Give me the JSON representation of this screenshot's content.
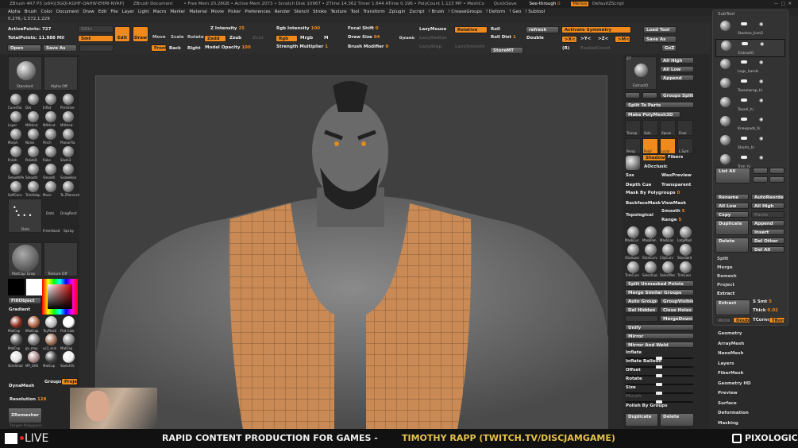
{
  "title": {
    "app": "ZBrush 4R7 P3 (x64)[3GQI-KGHF-QAHW-EHMI-NYAP]",
    "doc": "ZBrush Document",
    "stats": "• Free Mem 20.28GB • Active Mem 2073 • Scratch Disk 10967 • ZTime 14.362 Timer 1.644 ATime 0.196 • PolyCount 1.123 MP • MeshCo",
    "quicksave": "QuickSave",
    "seethrough": "See-through",
    "seethrough_val": "0",
    "menus": "Menus",
    "script": "DefaultZScript"
  },
  "menu": [
    "Alpha",
    "Brush",
    "Color",
    "Document",
    "Draw",
    "Edit",
    "File",
    "Layer",
    "Light",
    "Macro",
    "Marker",
    "Material",
    "Movie",
    "Picker",
    "Preferences",
    "Render",
    "Stencil",
    "Stroke",
    "Texture",
    "Tool",
    "Transform",
    "Zplugin",
    "Zscript",
    "! Brush",
    "! CreaseGroups",
    "! Deform",
    "! Geo",
    "! Subtool"
  ],
  "coords": "0.276,-1.572,1.229",
  "toolbar": {
    "active_points": "ActivePoints: 727",
    "total_points": "TotalPoints: 11.988 Mil",
    "sdiv": "SDiv",
    "smt": "Smt",
    "open": "Open",
    "save_as": "Save As",
    "edit": "Edit",
    "draw": "Draw",
    "move": "Move",
    "scale": "Scale",
    "rotate": "Rotate",
    "front": "Front",
    "back": "Back",
    "right": "Right",
    "z_intensity": "Z Intensity",
    "z_intensity_val": "25",
    "zadd": "Zadd",
    "zsub": "Zsub",
    "zcut": "Zcut",
    "model_opacity": "Model Opacity",
    "model_opacity_val": "100",
    "rgb_intensity": "Rgb Intensity",
    "rgb_intensity_val": "100",
    "rgb": "Rgb",
    "mrgb": "Mrgb",
    "m": "M",
    "strength_mult": "Strength Multiplier",
    "strength_mult_val": "1",
    "focal_shift": "Focal Shift",
    "focal_shift_val": "0",
    "draw_size": "Draw Size",
    "draw_size_val": "94",
    "dynamic": "Dynamic",
    "brush_modifier": "Brush Modifier",
    "brush_modifier_val": "0",
    "lazymouse": "LazyMouse",
    "lazyradius": "LazyRadius",
    "lazystep": "LazyStep",
    "lazysmooth": "LazySmooth",
    "relative": "Relative",
    "roll": "Roll",
    "roll_dist": "Roll Dist",
    "roll_dist_val": "1",
    "storemt": "StoreMT",
    "refresh": "refresh",
    "double": "Double",
    "activate_symmetry": "Activate Symmetry",
    "sym_x": ">X<",
    "sym_y": ">Y<",
    "sym_z": ">Z<",
    "sym_m": ">M<",
    "r": "(R)",
    "radial_count": "RadialCount",
    "load_tool": "Load Tool",
    "save_as2": "Save As",
    "goz": "GoZ"
  },
  "left": {
    "brush": "Standard",
    "alpha": "Alpha Off",
    "brushes": [
      "CurveTul",
      "Dot",
      "Inflat",
      "Primitive",
      "Layer",
      "MAHcut",
      "MAHcut",
      "MAHcut",
      "Morph",
      "Noise",
      "Pinch",
      "PlanarFla",
      "Polish",
      "PolishD",
      "Rake",
      "Slash3",
      "SmoothPe",
      "Smooth",
      "Smooth",
      "SnakeHoo",
      "SoftConc",
      "TrimAdap",
      "Move",
      "To ZRemesh"
    ],
    "stroke": "Dots",
    "stroke2": "Dots",
    "dragrect": "DragRect",
    "freehand": "FreeHand",
    "spray": "Spray",
    "material": "MatCap Gray",
    "texture": "Texture Off",
    "fill_object": "FillObject",
    "gradient": "Gradient",
    "materials": [
      "MatCap",
      "IMatCap",
      "ToyPlasti",
      "Flat Colo",
      "MatCap",
      "gv_may",
      "uc2_skin",
      "MatCap",
      "SkinShad",
      "MP_GRE",
      "MatCap",
      "SketchTo"
    ],
    "dynamesh": "DynaMesh",
    "groups": "Groups",
    "project": "Projec",
    "resolution": "Resolution",
    "resolution_val": "128",
    "zremesher": "ZRemesher",
    "target": "Target Polygons"
  },
  "tool": {
    "count": "27",
    "name": "Extract0",
    "all_high": "All High",
    "all_low": "All Low",
    "append": "Append",
    "groups_split": "Groups Split",
    "split_parts": "Split To Parts",
    "make_polymesh": "Make PolyMesh3D",
    "icons": [
      "Transp",
      "Solo",
      "Xpose",
      "Floor",
      "Persp",
      "PolyF",
      "Local",
      "L.Sym"
    ],
    "shadows": "Shadows",
    "fibers": "Fibers",
    "aocclusion": "AOcclusic",
    "sss": "Sss",
    "waxpreview": "WaxPreview",
    "depth_cue": "Depth Cue",
    "transparent": "Transparent",
    "mask_polygroups": "Mask By Polygroups",
    "mask_polygroups_val": "0",
    "backfacemask": "BackfaceMask",
    "viewmask": "ViewMask",
    "topological": "Topological",
    "smooth": "Smooth",
    "smooth_val": "5",
    "range": "Range",
    "range_val": "5",
    "mask_icons": [
      "MaskCur",
      "MaskPen",
      "MaskLas",
      "LazyMasl",
      "SliceLass",
      "SliceCurv",
      "ClipCurv",
      "Standard",
      "TrimCurv",
      "SelectLas",
      "SelectRec",
      "TrimLass"
    ],
    "split_unmasked": "Split Unmasked Points",
    "merge_similar": "Merge Similar Groups",
    "auto_groups": "Auto Groups",
    "group_visible": "GroupVisible",
    "del_hidden": "Del Hidden",
    "close_holes": "Close Holes",
    "mergedown": "MergeDown",
    "unify": "Unify",
    "mirror": "Mirror",
    "mirror_weld": "Mirror And Weld",
    "inflate": "Inflate",
    "inflate_balloon": "Inflate Balloon",
    "offset": "Offset",
    "rotate": "Rotate",
    "size": "Size",
    "morph": "Morph",
    "polish_groups": "Polish By Groups",
    "duplicate": "Duplicate",
    "delete": "Delete"
  },
  "subtool": {
    "title": "SubTool",
    "items": [
      "Stanton_Icon2",
      "Extract0",
      "Legs_hands",
      "Tasselwrap_hi",
      "Tassel_hi",
      "Kneepads_hi",
      "Shorts_hi",
      "Trim_hi"
    ],
    "list_all": "List All",
    "rename": "Rename",
    "autoreorder": "AutoReorder",
    "all_low": "All Low",
    "all_high": "All High",
    "copy": "Copy",
    "paste": "Paste",
    "duplicate": "Duplicate",
    "append": "Append",
    "insert": "Insert",
    "delete": "Delete",
    "del_other": "Del Other",
    "del_all": "Del All",
    "split": "Split",
    "merge": "Merge",
    "remesh": "Remesh",
    "project": "Project",
    "extract_section": "Extract",
    "extract": "Extract",
    "s_smt": "S Smt",
    "s_smt_val": "5",
    "thick": "Thick",
    "thick_val": "0.02",
    "accept": "Accept",
    "double": "Double",
    "tcorne": "TCorne",
    "tborder": "TBorde"
  },
  "sections": [
    "Geometry",
    "ArrayMesh",
    "NanoMesh",
    "Layers",
    "FiberMesh",
    "Geometry HD",
    "Preview",
    "Surface",
    "Deformation",
    "Masking"
  ],
  "banner": {
    "live": "LIVE",
    "text": "RAPID CONTENT PRODUCTION FOR GAMES - ",
    "author": "TIMOTHY RAPP (TWITCH.TV/DISCJAMGAME)",
    "brand": "PIXOLOGIC"
  },
  "colors": {
    "accent": "#f08a1c",
    "vest": "#c98a55",
    "skin": "#7a7a7a"
  }
}
